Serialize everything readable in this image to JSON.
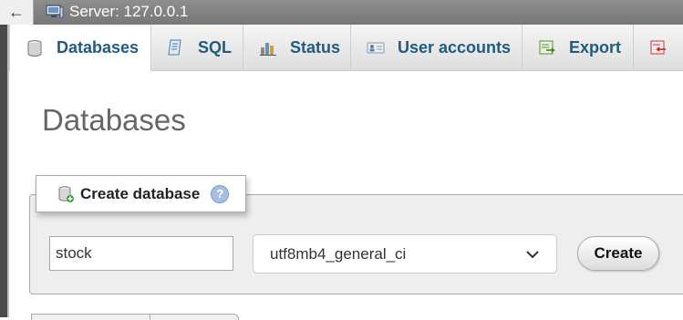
{
  "topbar": {
    "back_glyph": "←",
    "server_label": "Server: 127.0.0.1",
    "server_icon": "server-monitor-icon"
  },
  "tabs": [
    {
      "label": "Databases",
      "icon": "database-cylinder-icon",
      "active": true
    },
    {
      "label": "SQL",
      "icon": "sql-page-icon",
      "active": false
    },
    {
      "label": "Status",
      "icon": "status-chart-icon",
      "active": false
    },
    {
      "label": "User accounts",
      "icon": "user-card-icon",
      "active": false
    },
    {
      "label": "Export",
      "icon": "export-icon",
      "active": false
    },
    {
      "label": "",
      "icon": "import-icon",
      "active": false
    }
  ],
  "page": {
    "title": "Databases"
  },
  "create_db": {
    "legend": "Create database",
    "help_glyph": "?",
    "name_value": "stock",
    "collation_value": "utf8mb4_general_ci",
    "create_label": "Create"
  },
  "colors": {
    "tab_text": "#235a81",
    "title_text": "#666666",
    "panel_bg": "#eeeeee",
    "topbar_bg": "#808080"
  }
}
